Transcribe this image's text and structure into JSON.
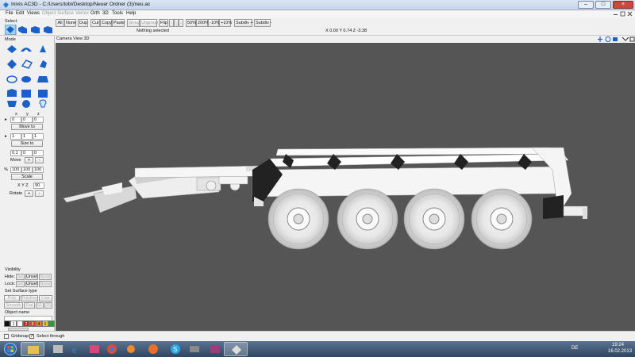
{
  "window": {
    "title": "Inivis AC3D - C:/Users/tobi/Desktop/Neuer Ordner (3)/neu.ac"
  },
  "menu": [
    "File",
    "Edit",
    "Views",
    "Object",
    "Surface",
    "Vertex",
    "Orth",
    "3D",
    "Tools",
    "Help"
  ],
  "menu_dim": [
    false,
    false,
    false,
    true,
    true,
    true,
    false,
    false,
    false,
    false
  ],
  "toolbar": {
    "select_label": "Select",
    "all": "All",
    "none": "None",
    "dup": "Dup",
    "cut": "Cut",
    "copy": "Copy",
    "paste": "Paste",
    "group": "Group",
    "ungroup": "Ungroup",
    "flip": "Flip",
    "zoom50": "50%",
    "zoom200": "200%",
    "zoom_minus10": "-10%",
    "zoom_plus10": "+10%",
    "subdiv_plus": "Subdiv +",
    "subdiv_minus": "Subdiv -",
    "selection_status": "Nothing selected",
    "coords": "X 0.00 Y 0.74 Z -3.38"
  },
  "left_panel": {
    "mode_label": "Mode",
    "axis_x": "x",
    "axis_y": "y",
    "axis_z": "z",
    "move_values": [
      "0",
      "0",
      "0"
    ],
    "move_to": "Move to",
    "size_values": [
      "1",
      "1",
      "1"
    ],
    "size_to": "Size to",
    "move_step": "0.1",
    "move_step_values": [
      "0",
      "0"
    ],
    "move": "Move",
    "percent": "%",
    "scale_values": [
      "100",
      "100",
      "100"
    ],
    "scale": "Scale",
    "rotate_axes": "X Y Z",
    "rotate_angle": "90",
    "rotate": "Rotate",
    "plus": "+",
    "minus": "-",
    "visibility_label": "Visibility",
    "hide_label": "Hide:",
    "lock_label": "Lock:",
    "sel": "Sel",
    "unsel": "Unsel",
    "none": "None",
    "surface_label": "Set Surface type",
    "poly": "Poly",
    "polyline": "Polyline",
    "line": "Line",
    "smooth": "Smooth",
    "flat": "Flat",
    "s1": "S1",
    "s2": "2S",
    "object_name_label": "Object name",
    "palette": [
      "1",
      "2",
      "3",
      "4",
      "5"
    ]
  },
  "viewport": {
    "label": "Camera View 3D"
  },
  "status": {
    "gridsnap": "Gridsnap",
    "select_through": "Select through"
  },
  "taskbar": {
    "lang": "DE",
    "time": "19:24",
    "date": "16.02.2013"
  },
  "colors": {
    "viewport_bg": "#555555",
    "accent_blue": "#1a60c8",
    "taskbar": "#3a5470"
  }
}
